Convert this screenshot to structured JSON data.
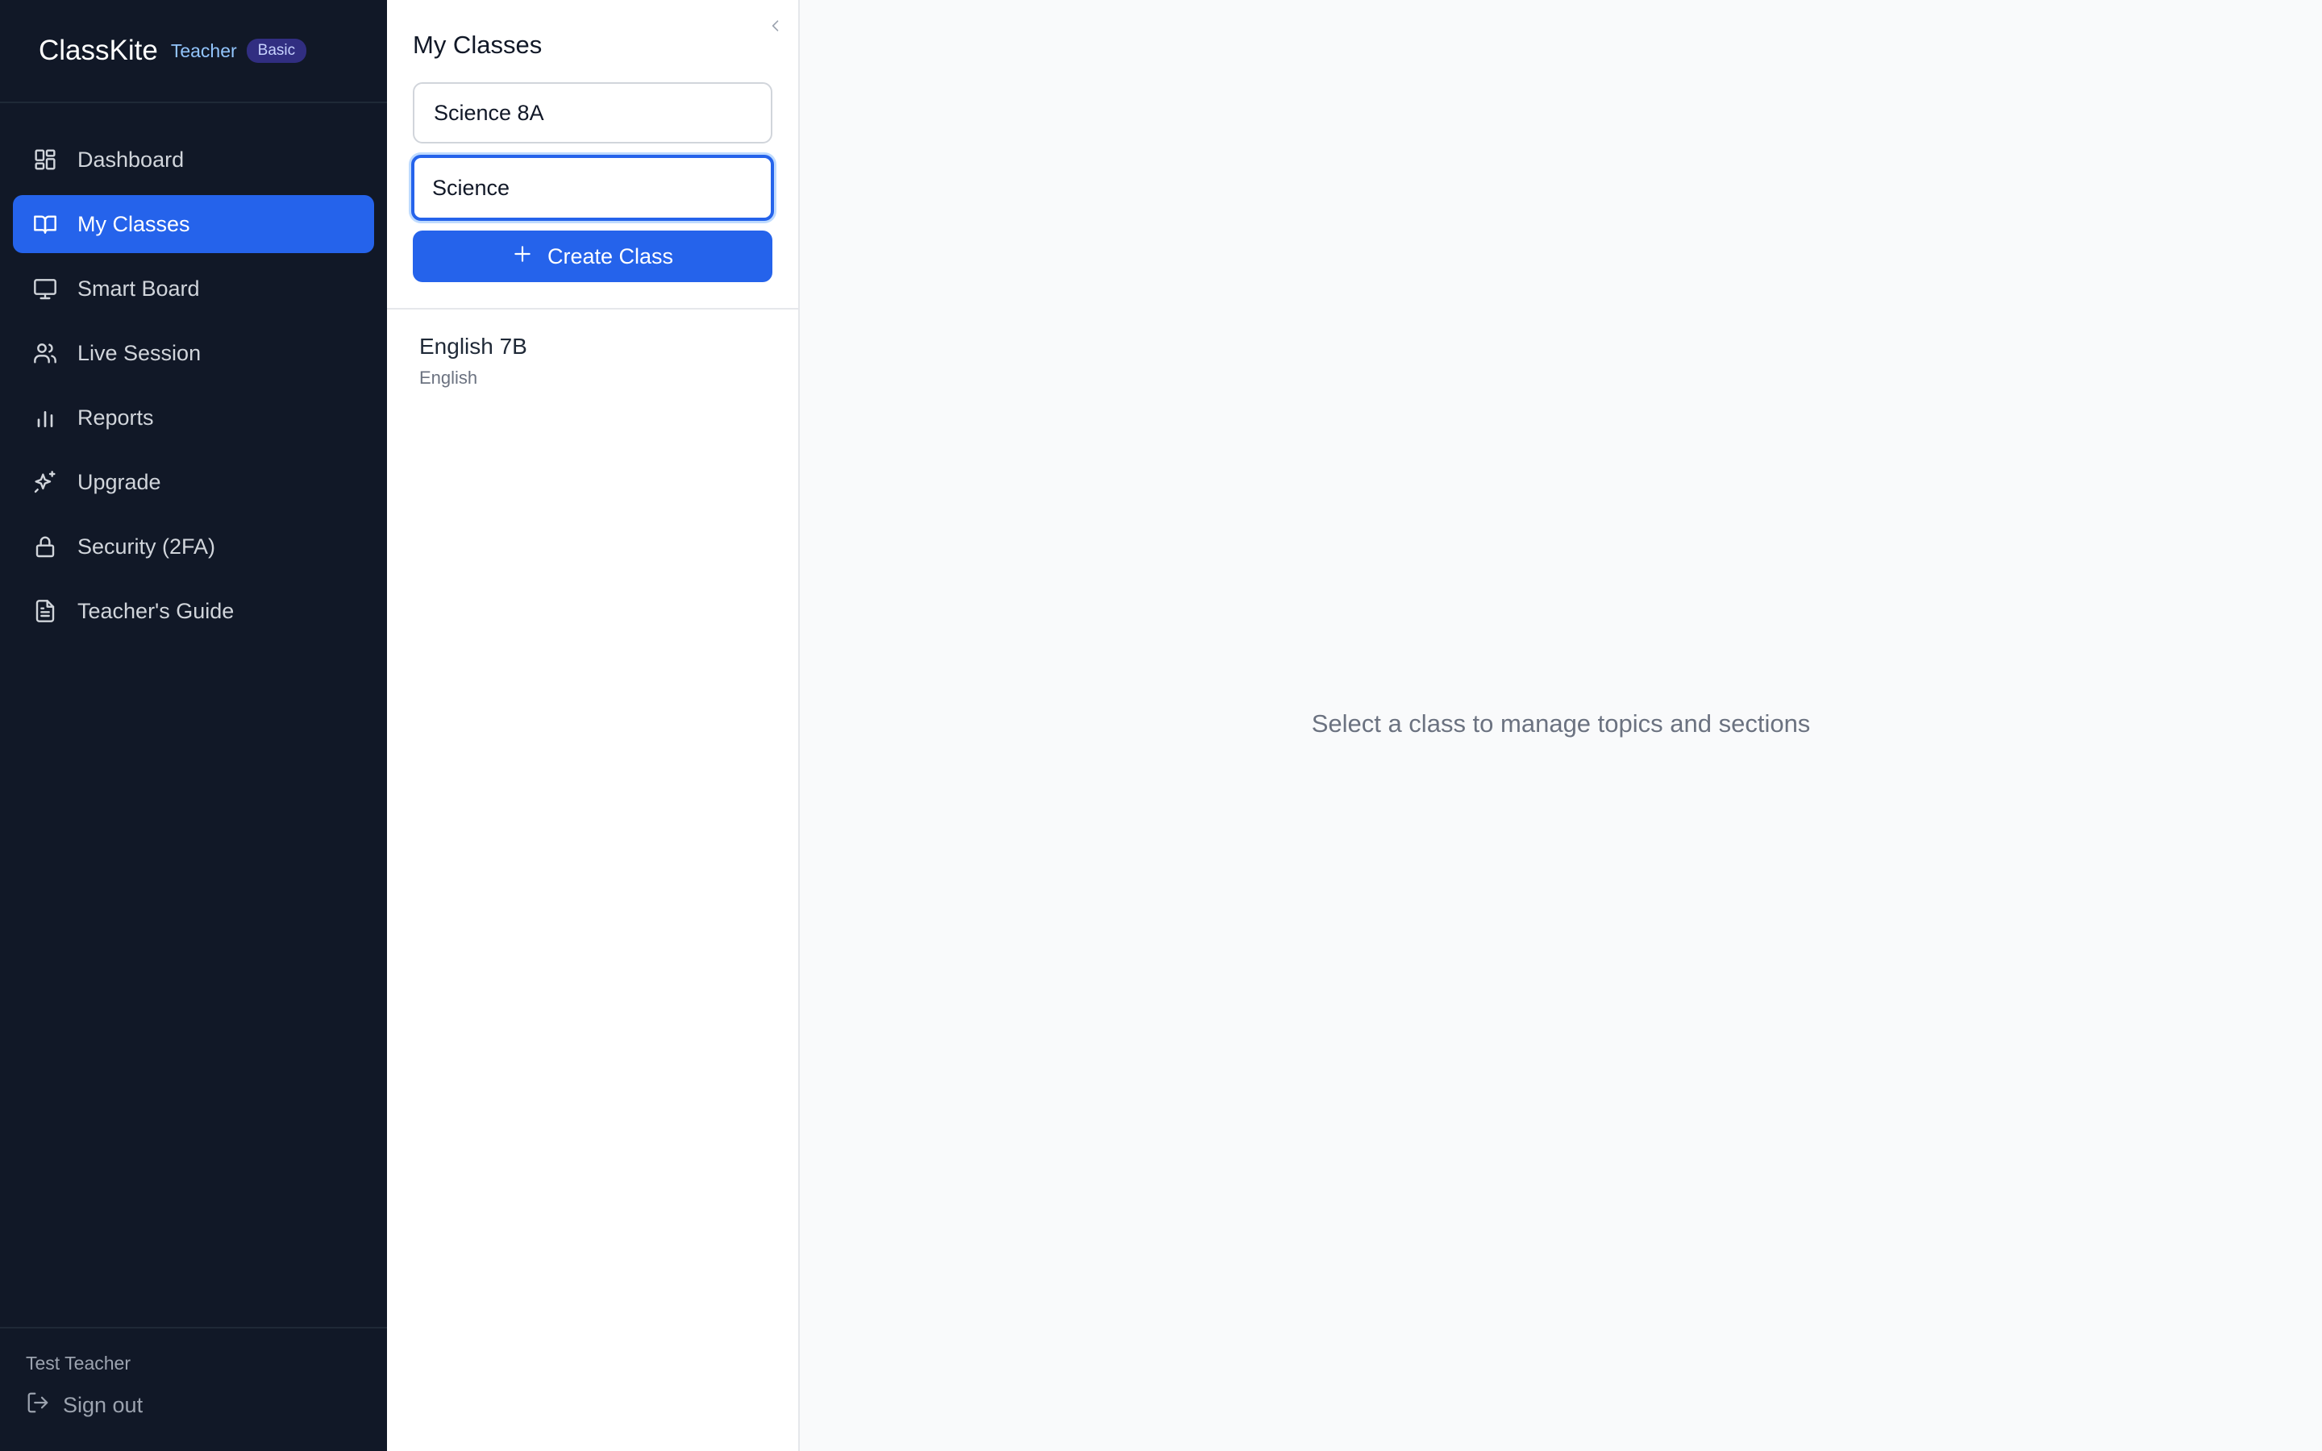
{
  "brand": {
    "name": "ClassKite",
    "role": "Teacher",
    "plan": "Basic"
  },
  "nav": [
    {
      "label": "Dashboard",
      "icon": "dashboard-icon",
      "active": false
    },
    {
      "label": "My Classes",
      "icon": "book-open-icon",
      "active": true
    },
    {
      "label": "Smart Board",
      "icon": "monitor-icon",
      "active": false
    },
    {
      "label": "Live Session",
      "icon": "users-icon",
      "active": false
    },
    {
      "label": "Reports",
      "icon": "bar-chart-icon",
      "active": false
    },
    {
      "label": "Upgrade",
      "icon": "sparkles-icon",
      "active": false
    },
    {
      "label": "Security (2FA)",
      "icon": "lock-icon",
      "active": false
    },
    {
      "label": "Teacher's Guide",
      "icon": "file-text-icon",
      "active": false
    }
  ],
  "user": {
    "name": "Test Teacher",
    "signout_label": "Sign out"
  },
  "panel": {
    "title": "My Classes",
    "class_name_value": "Science 8A",
    "subject_value": "Science",
    "create_label": "Create Class",
    "classes": [
      {
        "name": "English 7B",
        "subject": "English"
      }
    ]
  },
  "main": {
    "empty_message": "Select a class to manage topics and sections"
  },
  "colors": {
    "sidebar_bg": "#111827",
    "accent": "#2563eb",
    "main_bg": "#f9fafb"
  }
}
